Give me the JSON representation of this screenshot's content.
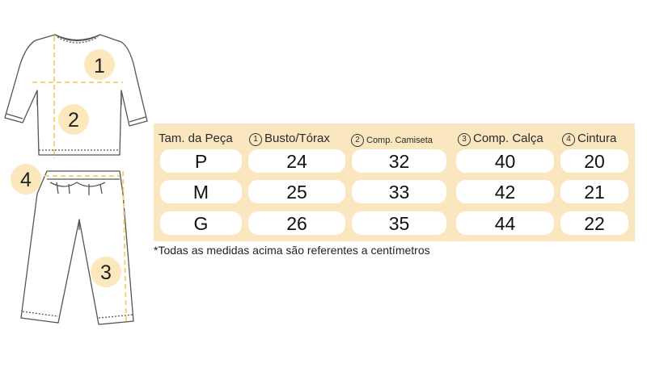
{
  "colors": {
    "accent": "#fbe7bf",
    "marker": "#fde7bd",
    "guide_line": "#f6d27a"
  },
  "callouts": [
    "1",
    "2",
    "3",
    "4"
  ],
  "table": {
    "headers": [
      {
        "label": "Tam. da Peça"
      },
      {
        "num": "1",
        "label": "Busto/Tórax"
      },
      {
        "num": "2",
        "label": "Comp. Camiseta"
      },
      {
        "num": "3",
        "label": "Comp. Calça"
      },
      {
        "num": "4",
        "label": "Cintura"
      }
    ],
    "rows": [
      [
        "P",
        "24",
        "32",
        "40",
        "20"
      ],
      [
        "M",
        "25",
        "33",
        "42",
        "21"
      ],
      [
        "G",
        "26",
        "35",
        "44",
        "22"
      ]
    ]
  },
  "footnote": "*Todas as medidas acima são referentes a centímetros"
}
